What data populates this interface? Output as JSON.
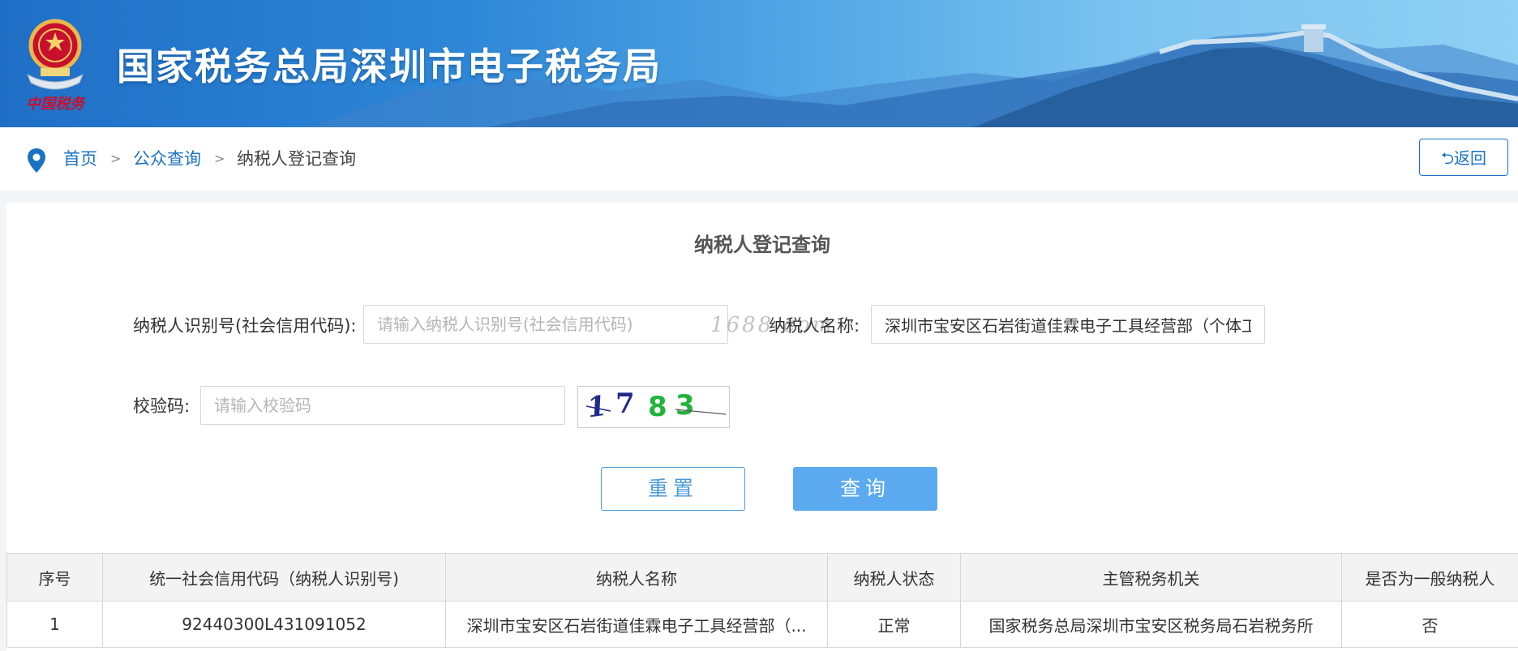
{
  "header": {
    "site_title": "国家税务总局深圳市电子税务局",
    "emblem_caption": "中国税务"
  },
  "breadcrumb": {
    "home": "首页",
    "section": "公众查询",
    "current": "纳税人登记查询",
    "separator": ">",
    "back_label": "⮌返回"
  },
  "form": {
    "title": "纳税人登记查询",
    "taxpayer_id": {
      "label": "纳税人识别号(社会信用代码):",
      "placeholder": "请输入纳税人识别号(社会信用代码)",
      "value": ""
    },
    "taxpayer_name": {
      "label": "纳税人名称:",
      "value": "深圳市宝安区石岩街道佳霖电子工具经营部（个体工商户）"
    },
    "captcha": {
      "label": "校验码:",
      "placeholder": "请输入校验码",
      "image_text": "1783"
    },
    "reset_label": "重置",
    "query_label": "查询"
  },
  "watermark": "1688.com",
  "table": {
    "headers": [
      "序号",
      "统一社会信用代码（纳税人识别号)",
      "纳税人名称",
      "纳税人状态",
      "主管税务机关",
      "是否为一般纳税人"
    ],
    "rows": [
      [
        "1",
        "92440300L431091052",
        "深圳市宝安区石岩街道佳霖电子工具经营部（...",
        "正常",
        "国家税务总局深圳市宝安区税务局石岩税务所",
        "否"
      ]
    ]
  },
  "colors": {
    "accent": "#1a73c2",
    "query_button": "#5baaf0",
    "banner": "#2d86d6"
  }
}
